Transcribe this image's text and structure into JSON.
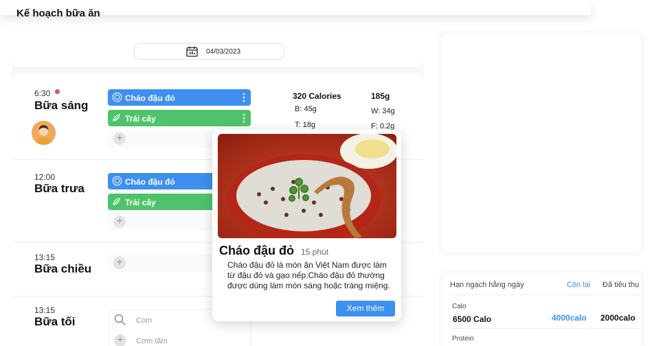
{
  "page": {
    "title": "Kế hoạch bữa ăn"
  },
  "date": {
    "value": "04/03/2023",
    "icon": "calendar-icon"
  },
  "meals": [
    {
      "time": "6:30",
      "name": "Bữa sáng",
      "items": [
        "Cháo đậu đỏ",
        "Trái cây"
      ]
    },
    {
      "time": "12:00",
      "name": "Bữa trưa",
      "items": [
        "Cháo đậu đỏ",
        "Trái cây"
      ]
    },
    {
      "time": "13:15",
      "name": "Bữa chiều",
      "items": []
    },
    {
      "time": "13:15",
      "name": "Bữa tối",
      "items": []
    }
  ],
  "breakfast_stats": {
    "calories": "320 Calories",
    "weight": "185g",
    "b": "B: 45g",
    "t": "T: 18g",
    "w": "W: 34g",
    "f": "F: 0.2g"
  },
  "dinner_suggestions": [
    "Com",
    "Cơm tấm"
  ],
  "popup": {
    "title": "Cháo đậu đỏ",
    "time": "15 phút",
    "description": "Cháo đậu đỏ là món ăn Việt Nam được làm từ đậu đỏ và gạo nếp.Cháo đậu đỏ thường được dùng làm món sáng hoặc tráng miệng.",
    "button": "Xem thêm"
  },
  "quota": {
    "header": "Hạn ngạch hằng ngày",
    "col_remaining": "Còn lại",
    "col_consumed": "Đã tiêu thụ",
    "rows": [
      {
        "label": "Calo",
        "total": "6500 Calo",
        "remaining": "4000calo",
        "consumed": "2000calo"
      },
      {
        "label": "Protein"
      }
    ]
  },
  "colors": {
    "blue": "#3d8ff0",
    "green": "#4fc36b",
    "dot": "#e05252"
  }
}
